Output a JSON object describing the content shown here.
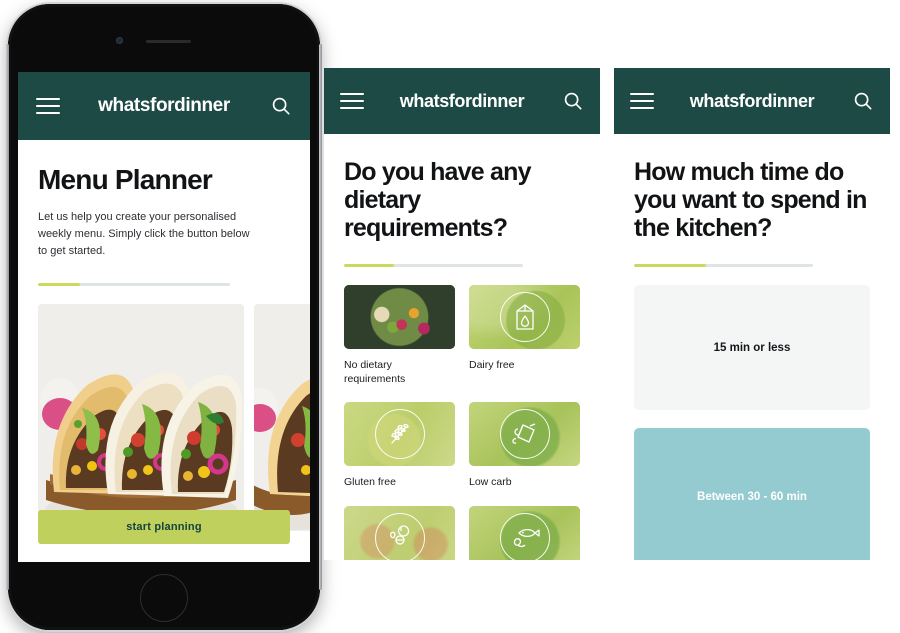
{
  "brand": "whatsfordinner",
  "theme": {
    "header_green": "#1d4a45",
    "lime": "#ccd95f",
    "button_lime": "#bfd05c",
    "button_text": "#14433d",
    "teal_selected": "#93cbd0",
    "card_grey": "#f4f5f5",
    "progress_track": "#dfe4e7"
  },
  "icons": {
    "menu": "hamburger-menu-icon",
    "search": "search-icon"
  },
  "screen1": {
    "title": "Menu Planner",
    "subtext": "Let us help you create your personalised weekly menu. Simply click the button below to get started.",
    "progress_percent": 22,
    "cta_label": "start planning",
    "carousel": [
      {
        "alt": "beef tacos with avocado, tomato and pickled onion"
      },
      {
        "alt": "beef tacos second slide"
      }
    ]
  },
  "screen2": {
    "title": "Do you have any dietary requirements?",
    "progress_percent": 28,
    "options": [
      {
        "label": "No dietary requirements",
        "icon": "salad-bowl-photo",
        "style": "photo"
      },
      {
        "label": "Dairy free",
        "icon": "milk-carton-icon",
        "style": "green-a"
      },
      {
        "label": "Gluten free",
        "icon": "wheat-sheaf-icon",
        "style": "green-b"
      },
      {
        "label": "Low carb",
        "icon": "bread-slice-icon",
        "style": "green-d"
      },
      {
        "label": "",
        "icon": "vegetarian-icon",
        "style": "green-c"
      },
      {
        "label": "",
        "icon": "fish-icon",
        "style": "green-d"
      }
    ]
  },
  "screen3": {
    "title": "How much time do you want to spend in the kitchen?",
    "progress_percent": 40,
    "options": [
      {
        "label": "15 min or less",
        "selected": false
      },
      {
        "label": "Between 30 - 60 min",
        "selected": true
      }
    ]
  }
}
